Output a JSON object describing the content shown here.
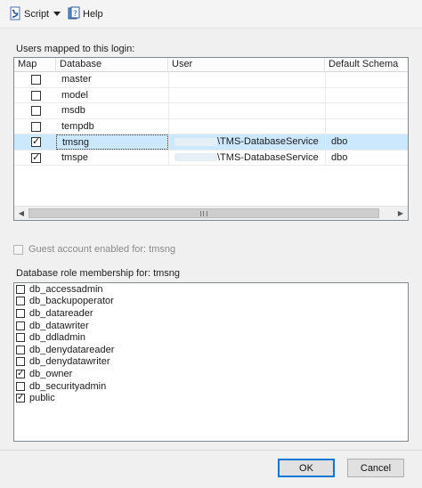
{
  "toolbar": {
    "script_label": "Script",
    "help_label": "Help"
  },
  "users_section": {
    "label": "Users mapped to this login:",
    "columns": [
      "Map",
      "Database",
      "User",
      "Default Schema"
    ],
    "rows": [
      {
        "map": false,
        "database": "master",
        "user": "",
        "schema": ""
      },
      {
        "map": false,
        "database": "model",
        "user": "",
        "schema": ""
      },
      {
        "map": false,
        "database": "msdb",
        "user": "",
        "schema": ""
      },
      {
        "map": false,
        "database": "tempdb",
        "user": "",
        "schema": ""
      },
      {
        "map": true,
        "database": "tmsng",
        "user": "\\TMS-DatabaseService",
        "schema": "dbo"
      },
      {
        "map": true,
        "database": "tmspe",
        "user": "\\TMS-DatabaseService",
        "schema": "dbo"
      }
    ],
    "selected_row": 4
  },
  "guest": {
    "label": "Guest account enabled for: tmsng",
    "checked": false
  },
  "role_section": {
    "label": "Database role membership for: tmsng",
    "roles": [
      {
        "name": "db_accessadmin",
        "checked": false
      },
      {
        "name": "db_backupoperator",
        "checked": false
      },
      {
        "name": "db_datareader",
        "checked": false
      },
      {
        "name": "db_datawriter",
        "checked": false
      },
      {
        "name": "db_ddladmin",
        "checked": false
      },
      {
        "name": "db_denydatareader",
        "checked": false
      },
      {
        "name": "db_denydatawriter",
        "checked": false
      },
      {
        "name": "db_owner",
        "checked": true
      },
      {
        "name": "db_securityadmin",
        "checked": false
      },
      {
        "name": "public",
        "checked": true
      }
    ]
  },
  "footer": {
    "ok_label": "OK",
    "cancel_label": "Cancel"
  }
}
